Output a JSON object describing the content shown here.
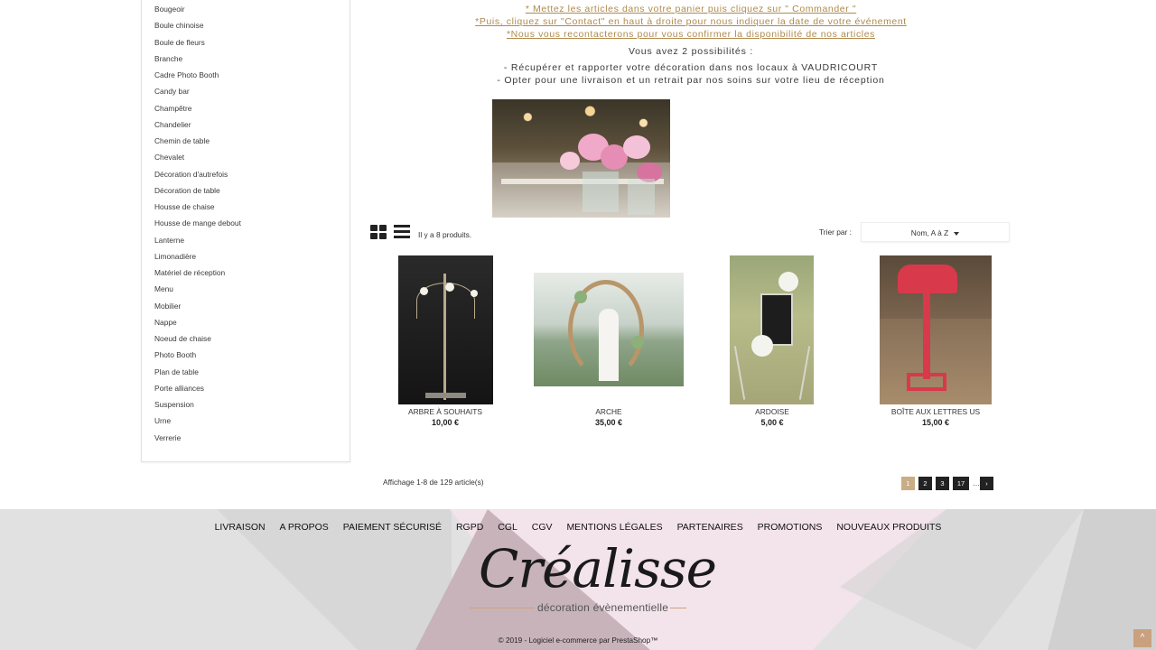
{
  "sidebar": {
    "categories": [
      "Bougeoir",
      "Boule chinoise",
      "Boule de fleurs",
      "Branche",
      "Cadre Photo Booth",
      "Candy bar",
      "Champêtre",
      "Chandelier",
      "Chemin de table",
      "Chevalet",
      "Décoration d'autrefois",
      "Décoration de table",
      "Housse de chaise",
      "Housse de mange debout",
      "Lanterne",
      "Limonadière",
      "Matériel de réception",
      "Menu",
      "Mobilier",
      "Nappe",
      "Noeud de chaise",
      "Photo Booth",
      "Plan de table",
      "Porte alliances",
      "Suspension",
      "Urne",
      "Verrerie"
    ]
  },
  "notice": {
    "line1": "* Mettez les articles dans votre panier puis cliquez sur \" Commander \"",
    "line2": "*Puis, cliquez sur \"Contact\" en haut à droite pour nous indiquer la date de votre événement",
    "line3": "*Nous vous recontacterons pour vous confirmer la disponibilité de nos articles",
    "line4": "Vous avez 2 possibilités :",
    "line5": "- Récupérer et rapporter votre décoration dans nos locaux à VAUDRICOURT",
    "line6": "- Opter pour une livraison et un retrait par nos soins sur votre lieu de réception"
  },
  "toolbar": {
    "count": "Il y a 8 produits.",
    "sort_label": "Trier par :",
    "sort_value": "Nom, A à Z",
    "grid_icon": "grid-view-icon",
    "list_icon": "list-view-icon"
  },
  "products": [
    {
      "name": "ARBRE À SOUHAITS",
      "price": "10,00 €"
    },
    {
      "name": "ARCHE",
      "price": "35,00 €"
    },
    {
      "name": "ARDOISE",
      "price": "5,00 €"
    },
    {
      "name": "BOÎTE AUX LETTRES US",
      "price": "15,00 €"
    }
  ],
  "pagination": {
    "showing": "Affichage 1-8 de 129 article(s)",
    "pages": [
      "1",
      "2",
      "3",
      "17"
    ],
    "current": "1",
    "ellipsis": "…",
    "next": "›"
  },
  "footer": {
    "nav": [
      "LIVRAISON",
      "A PROPOS",
      "PAIEMENT SÉCURISÉ",
      "RGPD",
      "CGL",
      "CGV",
      "MENTIONS LÉGALES",
      "PARTENAIRES",
      "PROMOTIONS",
      "NOUVEAUX PRODUITS"
    ],
    "logo_text": "Créalisse",
    "logo_sub": "décoration évènementielle",
    "copyright": "© 2019 - Logiciel e-commerce par PrestaShop™",
    "scroll_top_icon": "chevron-up-icon"
  },
  "colors": {
    "gold": "#b08a4d",
    "accent": "#c9ad85",
    "footer_bg": "#e1e1e1"
  }
}
